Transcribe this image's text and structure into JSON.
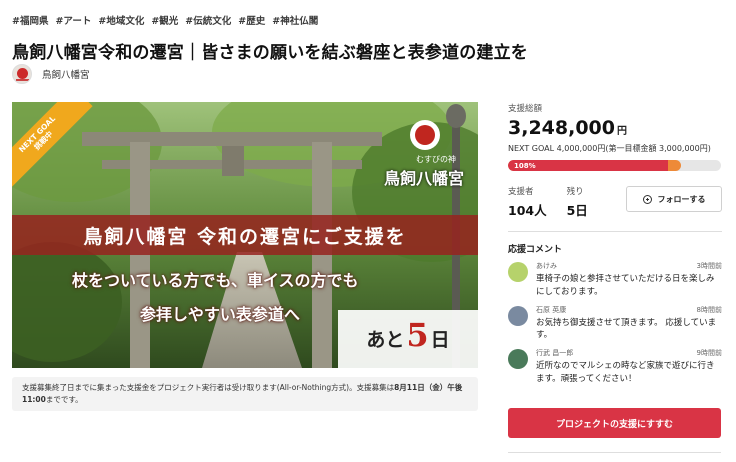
{
  "tags": [
    "#福岡県",
    "#アート",
    "#地域文化",
    "#観光",
    "#伝統文化",
    "#歴史",
    "#神社仏閣"
  ],
  "title": "鳥飼八幡宮令和の遷宮｜皆さまの願いを結ぶ磐座と表参道の建立を",
  "owner": {
    "name": "鳥飼八幡宮"
  },
  "hero": {
    "ribbon_line1": "NEXT GOAL",
    "ribbon_line2": "挑戦中",
    "logo_sub": "むすびの神",
    "logo_name": "鳥飼八幡宮",
    "banner": "鳥飼八幡宮 令和の遷宮にご支援を",
    "line1": "杖をついている方でも、車イスの方でも",
    "line2": "参拝しやすい表参道へ",
    "remain_prefix": "あと",
    "remain_num": "5",
    "remain_suffix": "日"
  },
  "notice": {
    "text1": "支援募集終了日までに集まった支援金をプロジェクト実行者は受け取ります(All-or-Nothing方式)。支援募集は",
    "bold": "8月11日（金）午後11:00",
    "text2": "までです。"
  },
  "funding": {
    "total_label": "支援総額",
    "amount": "3,248,000",
    "currency": "円",
    "next_goal": "NEXT GOAL 4,000,000円(第一目標金額 3,000,000円)",
    "progress_label": "108%",
    "progress_red_fraction": 0.75,
    "progress_orange_fraction": 0.81,
    "supporters_label": "支援者",
    "supporters_value": "104人",
    "remaining_label": "残り",
    "remaining_value": "5日",
    "follow_label": "フォローする",
    "colors": {
      "accent_red": "#d93445",
      "accent_orange": "#ee8a38"
    }
  },
  "comments": {
    "heading": "応援コメント",
    "items": [
      {
        "name": "あけみ",
        "time": "3時間前",
        "text": "車椅子の娘と参拝させていただける日を楽しみにしております。",
        "avatar_color": "#b6d26b"
      },
      {
        "name": "石原 英康",
        "time": "8時間前",
        "text": "お気持ち御支援させて頂きます。 応援しています。",
        "avatar_color": "#7a8aa0"
      },
      {
        "name": "行武 昌一郎",
        "time": "9時間前",
        "text": "近所なのでマルシェの時など家族で遊びに行きます。頑張ってください！",
        "avatar_color": "#4a7a5a"
      }
    ]
  },
  "support_button": "プロジェクトの支援にすすむ"
}
